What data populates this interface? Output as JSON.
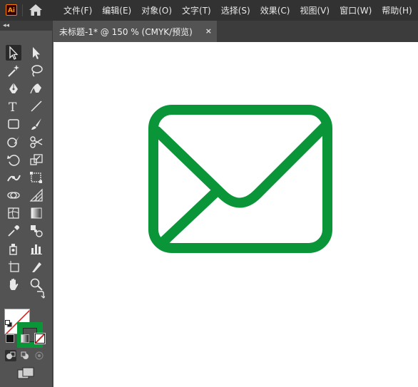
{
  "app": {
    "logo_text": "Ai",
    "brand_color": "#ff9a00"
  },
  "menu": [
    "文件(F)",
    "编辑(E)",
    "对象(O)",
    "文字(T)",
    "选择(S)",
    "效果(C)",
    "视图(V)",
    "窗口(W)",
    "帮助(H)"
  ],
  "document_tab": {
    "title": "未标题-1* @ 150 % (CMYK/预览)",
    "close": "×"
  },
  "toolbar": {
    "collapse": "◂◂"
  },
  "colors": {
    "stroke": "#0a9538",
    "fill": "none",
    "canvas": "#ffffff",
    "ui_dark": "#323232",
    "ui_mid": "#535353"
  },
  "artwork": {
    "name": "envelope-mail-icon",
    "stroke_color": "#0a9538"
  }
}
